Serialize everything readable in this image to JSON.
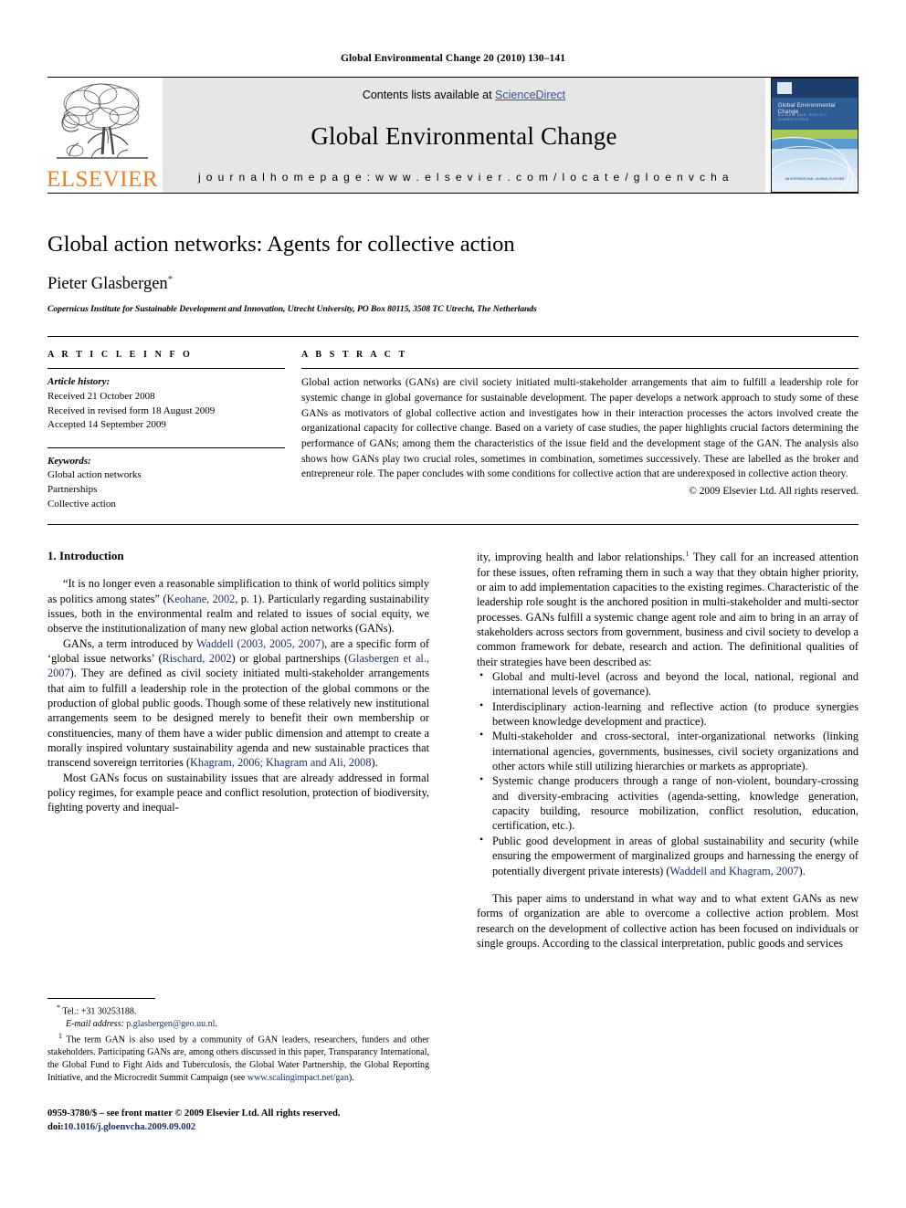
{
  "running_head": "Global Environmental Change 20 (2010) 130–141",
  "masthead": {
    "publisher_word": "ELSEVIER",
    "contents_prefix": "Contents lists available at ",
    "sciencedirect": "ScienceDirect",
    "journal_name": "Global Environmental Change",
    "homepage": "j o u r n a l   h o m e p a g e :   w w w . e l s e v i e r . c o m / l o c a t e / g l o e n v c h a",
    "cover": {
      "title": "Global Environmental Change",
      "subtitle": "HUMAN AND POLICY DIMENSIONS",
      "footer": "AN INTERNATIONAL JOURNAL\nELSEVIER"
    }
  },
  "article": {
    "title": "Global action networks: Agents for collective action",
    "author": "Pieter Glasbergen",
    "author_marker": "*",
    "affiliation": "Copernicus Institute for Sustainable Development and Innovation, Utrecht University, PO Box 80115, 3508 TC Utrecht, The Netherlands"
  },
  "article_info": {
    "heading": "A R T I C L E   I N F O",
    "history_label": "Article history:",
    "history": [
      "Received 21 October 2008",
      "Received in revised form 18 August 2009",
      "Accepted 14 September 2009"
    ],
    "keywords_label": "Keywords:",
    "keywords": [
      "Global action networks",
      "Partnerships",
      "Collective action"
    ]
  },
  "abstract": {
    "heading": "A B S T R A C T",
    "text": "Global action networks (GANs) are civil society initiated multi-stakeholder arrangements that aim to fulfill a leadership role for systemic change in global governance for sustainable development. The paper develops a network approach to study some of these GANs as motivators of global collective action and investigates how in their interaction processes the actors involved create the organizational capacity for collective change. Based on a variety of case studies, the paper highlights crucial factors determining the performance of GANs; among them the characteristics of the issue field and the development stage of the GAN. The analysis also shows how GANs play two crucial roles, sometimes in combination, sometimes successively. These are labelled as the broker and entrepreneur role. The paper concludes with some conditions for collective action that are underexposed in collective action theory.",
    "copyright": "© 2009 Elsevier Ltd. All rights reserved."
  },
  "body": {
    "section_title": "1. Introduction",
    "left_p1_a": "“It is no longer even a reasonable simplification to think of world politics simply as politics among states” (",
    "left_p1_cite1": "Keohane, 2002",
    "left_p1_b": ", p. 1). Particularly regarding sustainability issues, both in the environmental realm and related to issues of social equity, we observe the institutionalization of many new global action networks (GANs).",
    "left_p2_a": "GANs, a term introduced by ",
    "left_p2_cite1": "Waddell (2003, 2005, 2007)",
    "left_p2_b": ", are a specific form of ‘global issue networks’ (",
    "left_p2_cite2": "Rischard, 2002",
    "left_p2_c": ") or global partnerships (",
    "left_p2_cite3": "Glasbergen et al., 2007",
    "left_p2_d": "). They are defined as civil society initiated multi-stakeholder arrangements that aim to fulfill a leadership role in the protection of the global commons or the production of global public goods. Though some of these relatively new institutional arrangements seem to be designed merely to benefit their own membership or constituencies, many of them have a wider public dimension and attempt to create a morally inspired voluntary sustainability agenda and new sustainable practices that transcend sovereign territories (",
    "left_p2_cite4": "Khagram, 2006; Khagram and Ali, 2008",
    "left_p2_e": ").",
    "left_p3": "Most GANs focus on sustainability issues that are already addressed in formal policy regimes, for example peace and conflict resolution, protection of biodiversity, fighting poverty and inequal-",
    "right_p1_a": "ity, improving health and labor relationships.",
    "right_p1_sup": "1",
    "right_p1_b": " They call for an increased attention for these issues, often reframing them in such a way that they obtain higher priority, or aim to add implementation capacities to the existing regimes. Characteristic of the leadership role sought is the anchored position in multi-stakeholder and multi-sector processes. GANs fulfill a systemic change agent role and aim to bring in an array of stakeholders across sectors from government, business and civil society to develop a common framework for debate, research and action. The definitional qualities of their strategies have been described as:",
    "bullets": [
      "Global and multi-level (across and beyond the local, national, regional and international levels of governance).",
      "Interdisciplinary action-learning and reflective action (to produce synergies between knowledge development and practice).",
      "Multi-stakeholder and cross-sectoral, inter-organizational networks (linking international agencies, governments, businesses, civil society organizations and other actors while still utilizing hierarchies or markets as appropriate).",
      "Systemic change producers through a range of non-violent, boundary-crossing and diversity-embracing activities (agenda-setting, knowledge generation, capacity building, resource mobilization, conflict resolution, education, certification, etc.)."
    ],
    "bullet_last_a": "Public good development in areas of global sustainability and security (while ensuring the empowerment of marginalized groups and harnessing the energy of potentially divergent private interests) (",
    "bullet_last_cite": "Waddell and Khagram, 2007",
    "bullet_last_b": ").",
    "right_p2": "This paper aims to understand in what way and to what extent GANs as new forms of organization are able to overcome a collective action problem. Most research on the development of collective action has been focused on individuals or single groups. According to the classical interpretation, public goods and services"
  },
  "footnotes": {
    "tel_marker": "*",
    "tel": " Tel.: +31 30253188.",
    "email_label": "E-mail address:",
    "email": "p.glasbergen@geo.uu.nl",
    "note_marker": "1",
    "note_a": " The term GAN is also used by a community of GAN leaders, researchers, funders and other stakeholders. Participating GANs are, among others discussed in this paper, Transparancy International, the Global Fund to Fight Aids and Tuberculosis, the Global Water Partnership, the Global Reporting Initiative, and the Microcredit Summit Campaign (see ",
    "note_link": "www.scalingimpact.net/gan",
    "note_b": ")."
  },
  "page_footer": {
    "issn_line": "0959-3780/$ – see front matter © 2009 Elsevier Ltd. All rights reserved.",
    "doi_prefix": "doi:",
    "doi": "10.1016/j.gloenvcha.2009.09.002"
  },
  "colors": {
    "link": "#1c2f6e",
    "sciencedirect": "#3a4ea8",
    "elsevier_orange": "#ef7d22",
    "band_gray": "#e6e6e6"
  }
}
